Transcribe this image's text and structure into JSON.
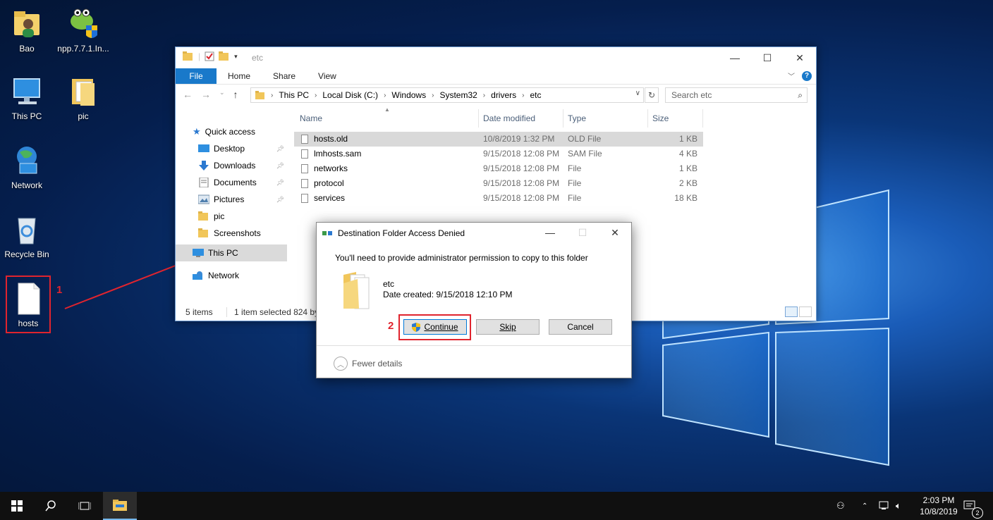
{
  "desktop": {
    "icons": [
      {
        "label": "Bao"
      },
      {
        "label": "npp.7.7.1.In..."
      },
      {
        "label": "This PC"
      },
      {
        "label": "pic"
      },
      {
        "label": "Network"
      },
      {
        "label": "Recycle Bin"
      },
      {
        "label": "hosts"
      }
    ],
    "annotation_1": "1",
    "annotation_2": "2"
  },
  "explorer": {
    "title": "etc",
    "ribbon_tabs": [
      "File",
      "Home",
      "Share",
      "View"
    ],
    "breadcrumb": [
      "This PC",
      "Local Disk (C:)",
      "Windows",
      "System32",
      "drivers",
      "etc"
    ],
    "search_placeholder": "Search etc",
    "nav": {
      "quick_access": "Quick access",
      "pinned": [
        "Desktop",
        "Downloads",
        "Documents",
        "Pictures"
      ],
      "folders": [
        "pic",
        "Screenshots"
      ],
      "this_pc": "This PC",
      "network": "Network"
    },
    "columns": [
      "Name",
      "Date modified",
      "Type",
      "Size"
    ],
    "files": [
      {
        "name": "hosts.old",
        "date": "10/8/2019 1:32 PM",
        "type": "OLD File",
        "size": "1 KB",
        "selected": true
      },
      {
        "name": "lmhosts.sam",
        "date": "9/15/2018 12:08 PM",
        "type": "SAM File",
        "size": "4 KB",
        "selected": false
      },
      {
        "name": "networks",
        "date": "9/15/2018 12:08 PM",
        "type": "File",
        "size": "1 KB",
        "selected": false
      },
      {
        "name": "protocol",
        "date": "9/15/2018 12:08 PM",
        "type": "File",
        "size": "2 KB",
        "selected": false
      },
      {
        "name": "services",
        "date": "9/15/2018 12:08 PM",
        "type": "File",
        "size": "18 KB",
        "selected": false
      }
    ],
    "status_items": "5 items",
    "status_selected": "1 item selected  824 byte"
  },
  "dialog": {
    "title": "Destination Folder Access Denied",
    "message": "You'll need to provide administrator permission to copy to this folder",
    "folder_name": "etc",
    "date_created": "Date created: 9/15/2018 12:10 PM",
    "buttons": {
      "continue": "Continue",
      "skip": "Skip",
      "cancel": "Cancel"
    },
    "fewer_details": "Fewer details"
  },
  "taskbar": {
    "time": "2:03 PM",
    "date": "10/8/2019",
    "notification_count": "2"
  },
  "colors": {
    "annotation_red": "#e0242e",
    "accent_blue": "#1979ca"
  }
}
